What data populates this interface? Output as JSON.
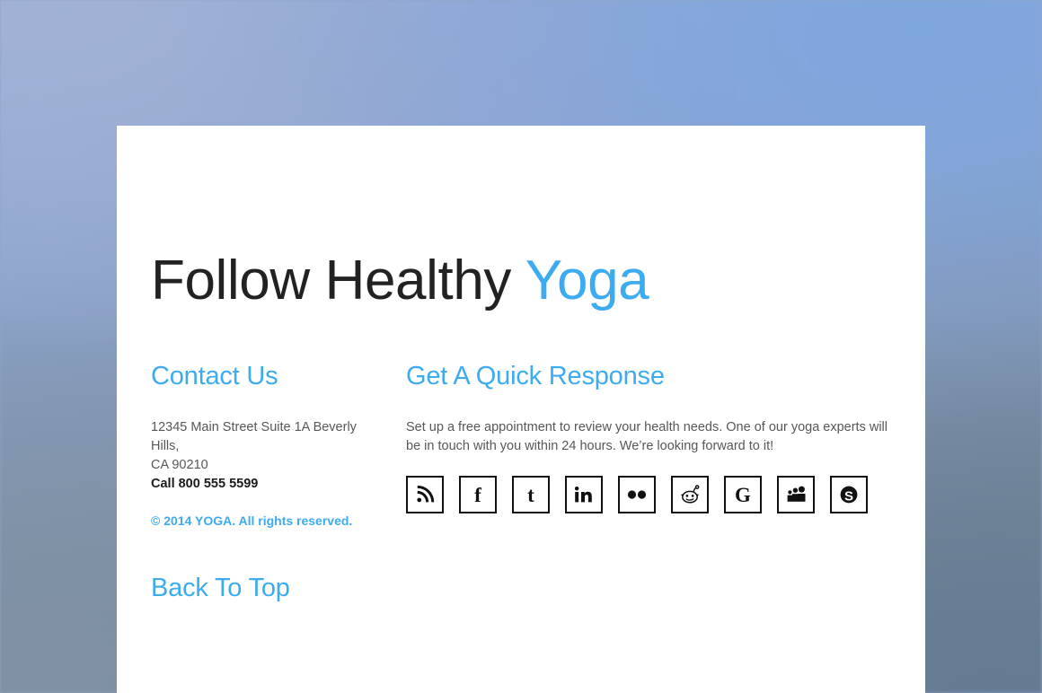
{
  "background": {
    "style": "blurred-sky-photo",
    "top_left_color": "#9fb2d8",
    "top_right_color": "#7ea6e0",
    "bottom_left_color": "#8092a3",
    "bottom_right_color": "#647b92"
  },
  "theme": {
    "accent": "#3dabf0",
    "card_background": "#ffffff",
    "body_text": "#575757",
    "strong_text": "#1b1b1b",
    "icon_border": "#111111"
  },
  "headline": {
    "text_plain": "Follow Healthy",
    "text_accent": "Yoga"
  },
  "contact": {
    "heading": "Contact Us",
    "address_line1": "12345 Main Street Suite 1A Beverly Hills,",
    "address_line2": "CA 90210",
    "phone": "Call 800 555 5599",
    "copyright": "© 2014 YOGA. All rights reserved."
  },
  "response": {
    "heading": "Get A Quick Response",
    "blurb": "Set up a free appointment to review your health needs. One of our yoga experts will be in touch with you within 24 hours. We’re looking forward to it!"
  },
  "social": [
    {
      "name": "rss-icon",
      "label": "RSS"
    },
    {
      "name": "facebook-icon",
      "label": "Facebook"
    },
    {
      "name": "twitter-icon",
      "label": "Twitter"
    },
    {
      "name": "linkedin-icon",
      "label": "LinkedIn"
    },
    {
      "name": "flickr-icon",
      "label": "Flickr"
    },
    {
      "name": "reddit-icon",
      "label": "Reddit"
    },
    {
      "name": "google-icon",
      "label": "Google"
    },
    {
      "name": "myspace-icon",
      "label": "MySpace"
    },
    {
      "name": "skype-icon",
      "label": "Skype"
    }
  ],
  "back_to_top": {
    "label": "Back To Top"
  }
}
